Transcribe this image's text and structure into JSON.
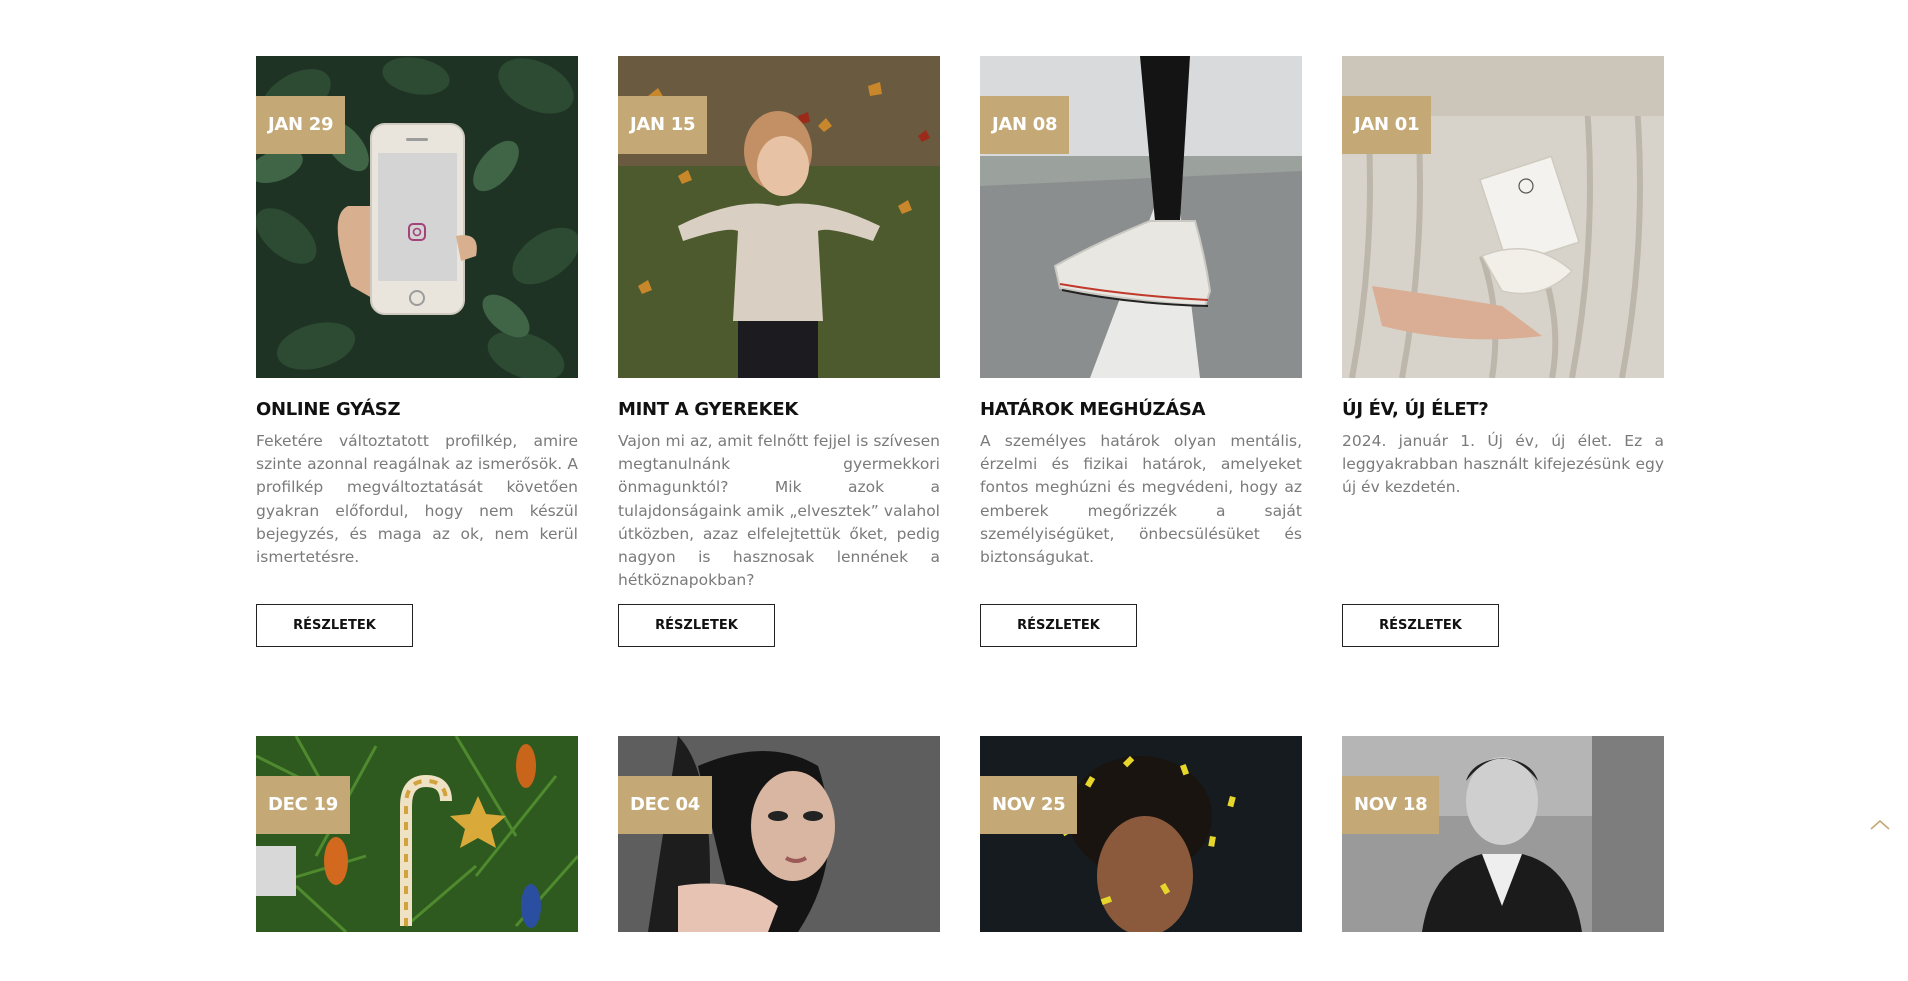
{
  "posts_row1": [
    {
      "date": "JAN 29",
      "title": "ONLINE GYÁSZ",
      "excerpt": "Feketére változtatott profilkép, amire szinte azonnal reagálnak az ismerősök. A profilkép megváltoztatását követően gyakran előfordul, hogy nem készül bejegyzés, és maga az ok, nem kerül ismertetésre.",
      "button": "RÉSZLETEK"
    },
    {
      "date": "JAN 15",
      "title": "MINT A GYEREKEK",
      "excerpt": "Vajon mi az, amit felnőtt fejjel is szívesen megtanulnánk gyermekkori önmagunktól? Mik azok a tulajdonságaink amik „elvesztek” valahol útközben, azaz elfelejtettük őket, pedig nagyon is hasznosak lennének a hétköznapokban?",
      "button": "RÉSZLETEK"
    },
    {
      "date": "JAN 08",
      "title": "HATÁROK MEGHÚZÁSA",
      "excerpt": "A személyes határok olyan mentális, érzelmi és fizikai határok, amelyeket fontos meghúzni és megvédeni, hogy az emberek megőrizzék a saját személyiségüket, önbecsülésüket és biztonságukat.",
      "button": "RÉSZLETEK"
    },
    {
      "date": "JAN 01",
      "title": "ÚJ ÉV, ÚJ ÉLET?",
      "excerpt": "2024. január 1. Új év, új élet. Ez a leggyakrabban használt kifejezésünk egy új év kezdetén.",
      "button": "RÉSZLETEK"
    }
  ],
  "posts_row2": [
    {
      "date": "DEC 19"
    },
    {
      "date": "DEC 04"
    },
    {
      "date": "NOV 25"
    },
    {
      "date": "NOV 18"
    }
  ],
  "colors": {
    "accent": "#c4a977",
    "title": "#111111",
    "text": "#7a7a7a"
  },
  "icons": {
    "scroll_top": "chevron-up-icon"
  }
}
